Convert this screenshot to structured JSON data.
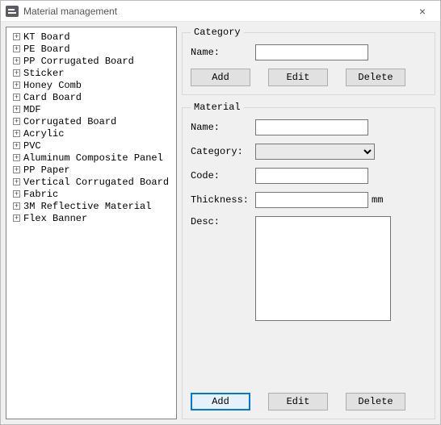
{
  "window": {
    "title": "Material management",
    "close_glyph": "×"
  },
  "tree": {
    "expander_glyph": "+",
    "items": [
      "KT Board",
      "PE Board",
      "PP Corrugated Board",
      "Sticker",
      "Honey Comb",
      "Card Board",
      "MDF",
      "Corrugated Board",
      "Acrylic",
      "PVC",
      "Aluminum Composite Panel",
      "PP Paper",
      "Vertical Corrugated Board",
      "Fabric",
      "3M Reflective Material",
      "Flex Banner"
    ]
  },
  "category": {
    "legend": "Category",
    "name_label": "Name:",
    "name_value": "",
    "add_label": "Add",
    "edit_label": "Edit",
    "delete_label": "Delete"
  },
  "material": {
    "legend": "Material",
    "name_label": "Name:",
    "name_value": "",
    "category_label": "Category:",
    "category_value": "",
    "code_label": "Code:",
    "code_value": "",
    "thickness_label": "Thickness:",
    "thickness_value": "",
    "thickness_unit": "mm",
    "desc_label": "Desc:",
    "desc_value": "",
    "add_label": "Add",
    "edit_label": "Edit",
    "delete_label": "Delete"
  }
}
